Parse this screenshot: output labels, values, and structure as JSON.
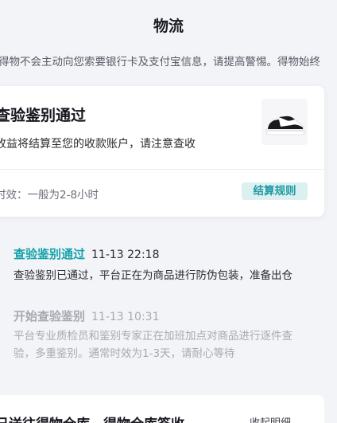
{
  "header": {
    "title": "物流"
  },
  "notice": {
    "text": "得物不会主动向您索要银行卡及支付宝信息，请提高警惕。得物始终"
  },
  "status_card": {
    "title": "查验鉴别通过",
    "subtitle": "收益将结算至您的收款账户，请注意查收",
    "time_text": "时效：一般为2-8小时",
    "settle_button": "结算规则",
    "product_icon": "sneaker-image"
  },
  "timeline": [
    {
      "title": "查验鉴别通过",
      "time": "11-13 22:18",
      "desc": [
        "查验鉴别已通过，平台正在为商品进行防伪包装，准备出仓"
      ],
      "state": "active"
    },
    {
      "title": "开始查验鉴别",
      "time": "11-13 10:31",
      "desc": [
        "平台专业质检员和鉴别专家正在加班加点对商品进行逐件查",
        "验，多重鉴别。通常时效为1-3天，请耐心等待"
      ],
      "state": "inactive"
    }
  ],
  "bottom_card": {
    "title": "已送往得物仓库，得物仓库签收",
    "collapse_label": "收起明细"
  },
  "colors": {
    "accent": "#15a3ab",
    "settle_bg": "#dcf0f1",
    "page_bg": "#f3f4f7"
  }
}
